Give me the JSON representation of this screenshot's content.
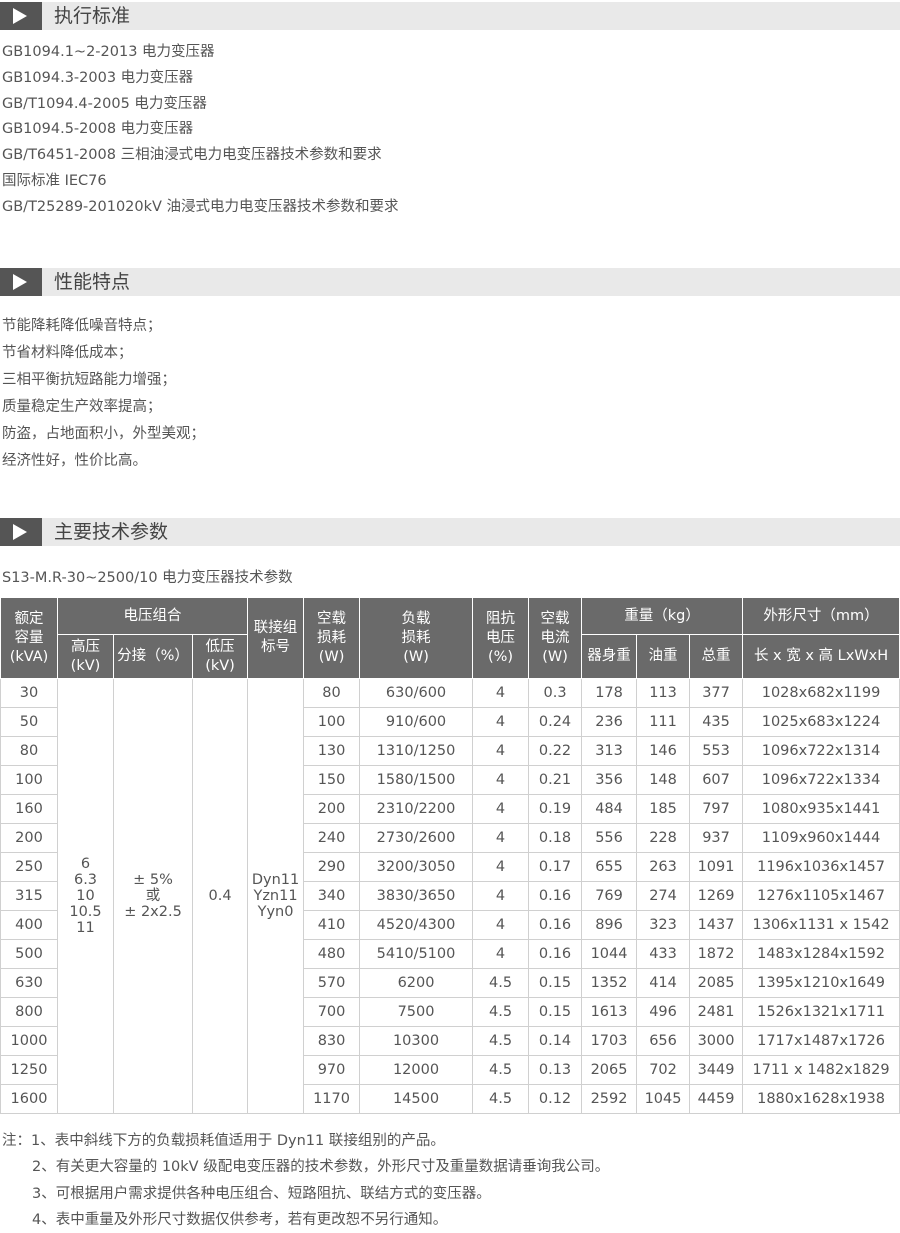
{
  "sections": {
    "standards_title": "执行标准",
    "features_title": "性能特点",
    "params_title": "主要技术参数"
  },
  "standards": [
    "GB1094.1~2-2013 电力变压器",
    "GB1094.3-2003 电力变压器",
    "GB/T1094.4-2005 电力变压器",
    "GB1094.5-2008 电力变压器",
    "GB/T6451-2008 三相油浸式电力电变压器技术参数和要求",
    "国际标准 IEC76",
    "GB/T25289-201020kV 油浸式电力电变压器技术参数和要求"
  ],
  "features": [
    "节能降耗降低噪音特点；",
    "节省材料降低成本；",
    "三相平衡抗短路能力增强；",
    "质量稳定生产效率提高；",
    "防盗，占地面积小，外型美观；",
    "经济性好，性价比高。"
  ],
  "table_caption": "S13-M.R-30~2500/10 电力变压器技术参数",
  "table": {
    "headers": {
      "capacity": [
        "额定",
        "容量",
        "(kVA)"
      ],
      "voltage_group": "电压组合",
      "hv": [
        "高压",
        "(kV)"
      ],
      "tap": "分接（%）",
      "lv": [
        "低压",
        "(kV)"
      ],
      "vector_group": [
        "联接组",
        "标号"
      ],
      "no_load_loss": [
        "空载",
        "损耗",
        "(W)"
      ],
      "load_loss": [
        "负载",
        "损耗",
        "(W)"
      ],
      "impedance": [
        "阻抗",
        "电压",
        "(%)"
      ],
      "no_load_current": [
        "空载",
        "电流",
        "(W)"
      ],
      "weight": "重量（kg）",
      "body_weight": "器身重",
      "oil_weight": "油重",
      "total_weight": "总重",
      "dimensions": "外形尺寸（mm）",
      "dims_sub": "长 x 宽 x 高 LxWxH"
    },
    "merged": {
      "hv": [
        "6",
        "6.3",
        "10",
        "10.5",
        "11"
      ],
      "tap": [
        "± 5%",
        "或",
        "± 2x2.5"
      ],
      "lv": "0.4",
      "vector": [
        "Dyn11",
        "Yzn11",
        "Yyn0"
      ]
    },
    "rows": [
      [
        "30",
        "80",
        "630/600",
        "4",
        "0.3",
        "178",
        "113",
        "377",
        "1028x682x1199"
      ],
      [
        "50",
        "100",
        "910/600",
        "4",
        "0.24",
        "236",
        "111",
        "435",
        "1025x683x1224"
      ],
      [
        "80",
        "130",
        "1310/1250",
        "4",
        "0.22",
        "313",
        "146",
        "553",
        "1096x722x1314"
      ],
      [
        "100",
        "150",
        "1580/1500",
        "4",
        "0.21",
        "356",
        "148",
        "607",
        "1096x722x1334"
      ],
      [
        "160",
        "200",
        "2310/2200",
        "4",
        "0.19",
        "484",
        "185",
        "797",
        "1080x935x1441"
      ],
      [
        "200",
        "240",
        "2730/2600",
        "4",
        "0.18",
        "556",
        "228",
        "937",
        "1109x960x1444"
      ],
      [
        "250",
        "290",
        "3200/3050",
        "4",
        "0.17",
        "655",
        "263",
        "1091",
        "1196x1036x1457"
      ],
      [
        "315",
        "340",
        "3830/3650",
        "4",
        "0.16",
        "769",
        "274",
        "1269",
        "1276x1105x1467"
      ],
      [
        "400",
        "410",
        "4520/4300",
        "4",
        "0.16",
        "896",
        "323",
        "1437",
        "1306x1131 x 1542"
      ],
      [
        "500",
        "480",
        "5410/5100",
        "4",
        "0.16",
        "1044",
        "433",
        "1872",
        "1483x1284x1592"
      ],
      [
        "630",
        "570",
        "6200",
        "4.5",
        "0.15",
        "1352",
        "414",
        "2085",
        "1395x1210x1649"
      ],
      [
        "800",
        "700",
        "7500",
        "4.5",
        "0.15",
        "1613",
        "496",
        "2481",
        "1526x1321x1711"
      ],
      [
        "1000",
        "830",
        "10300",
        "4.5",
        "0.14",
        "1703",
        "656",
        "3000",
        "1717x1487x1726"
      ],
      [
        "1250",
        "970",
        "12000",
        "4.5",
        "0.13",
        "2065",
        "702",
        "3449",
        "1711 x 1482x1829"
      ],
      [
        "1600",
        "1170",
        "14500",
        "4.5",
        "0.12",
        "2592",
        "1045",
        "4459",
        "1880x1628x1938"
      ]
    ]
  },
  "notes": [
    "注：1、表中斜线下方的负载损耗值适用于 Dyn11 联接组别的产品。",
    "2、有关更大容量的 10kV 级配电变压器的技术参数，外形尺寸及重量数据请垂询我公司。",
    "3、可根据用户需求提供各种电压组合、短路阻抗、联结方式的变压器。",
    "4、表中重量及外形尺寸数据仅供参考，若有更改恕不另行通知。"
  ],
  "colors": {
    "header_bg": "#6a6a6a",
    "section_bar": "#e9e9e9",
    "icon_box": "#555555",
    "text": "#555555"
  }
}
